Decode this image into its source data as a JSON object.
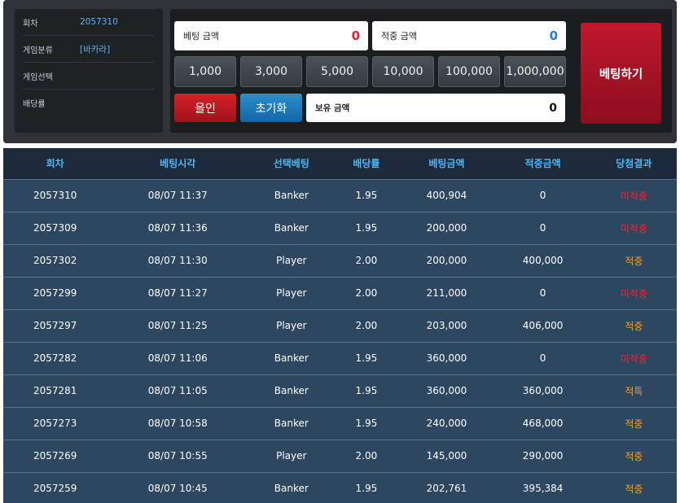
{
  "info": {
    "rows": [
      {
        "label": "회차",
        "value": "2057310"
      },
      {
        "label": "게임분류",
        "value": "[바카라]"
      },
      {
        "label": "게임선택",
        "value": ""
      },
      {
        "label": "배당률",
        "value": ""
      }
    ]
  },
  "bet": {
    "bet_amount_label": "베팅 금액",
    "bet_amount_value": "0",
    "win_amount_label": "적중 금액",
    "win_amount_value": "0",
    "chips": [
      "1,000",
      "3,000",
      "5,000",
      "10,000",
      "100,000",
      "1,000,000"
    ],
    "allin_label": "올인",
    "reset_label": "초기화",
    "owned_label": "보유 금액",
    "owned_value": "0",
    "bet_button_label": "베팅하기"
  },
  "colors": {
    "lose": "#e02a30",
    "win": "#f0a030",
    "accent_blue": "#52b3f2"
  },
  "history": {
    "headers": [
      "회차",
      "베팅시각",
      "선택베팅",
      "배당률",
      "베팅금액",
      "적중금액",
      "당첨결과"
    ],
    "rows": [
      {
        "round": "2057310",
        "time": "08/07 11:37",
        "pick": "Banker",
        "odds": "1.95",
        "bet": "400,904",
        "win": "0",
        "result": "미적중",
        "status": "lose"
      },
      {
        "round": "2057309",
        "time": "08/07 11:36",
        "pick": "Banker",
        "odds": "1.95",
        "bet": "200,000",
        "win": "0",
        "result": "미적중",
        "status": "lose"
      },
      {
        "round": "2057302",
        "time": "08/07 11:30",
        "pick": "Player",
        "odds": "2.00",
        "bet": "200,000",
        "win": "400,000",
        "result": "적중",
        "status": "win"
      },
      {
        "round": "2057299",
        "time": "08/07 11:27",
        "pick": "Player",
        "odds": "2.00",
        "bet": "211,000",
        "win": "0",
        "result": "미적중",
        "status": "lose"
      },
      {
        "round": "2057297",
        "time": "08/07 11:25",
        "pick": "Player",
        "odds": "2.00",
        "bet": "203,000",
        "win": "406,000",
        "result": "적중",
        "status": "win"
      },
      {
        "round": "2057282",
        "time": "08/07 11:06",
        "pick": "Banker",
        "odds": "1.95",
        "bet": "360,000",
        "win": "0",
        "result": "미적중",
        "status": "lose"
      },
      {
        "round": "2057281",
        "time": "08/07 11:05",
        "pick": "Banker",
        "odds": "1.95",
        "bet": "360,000",
        "win": "360,000",
        "result": "적특",
        "status": "win"
      },
      {
        "round": "2057273",
        "time": "08/07 10:58",
        "pick": "Banker",
        "odds": "1.95",
        "bet": "240,000",
        "win": "468,000",
        "result": "적중",
        "status": "win"
      },
      {
        "round": "2057269",
        "time": "08/07 10:55",
        "pick": "Player",
        "odds": "2.00",
        "bet": "145,000",
        "win": "290,000",
        "result": "적중",
        "status": "win"
      },
      {
        "round": "2057259",
        "time": "08/07 10:45",
        "pick": "Banker",
        "odds": "1.95",
        "bet": "202,761",
        "win": "395,384",
        "result": "적중",
        "status": "win"
      }
    ]
  }
}
